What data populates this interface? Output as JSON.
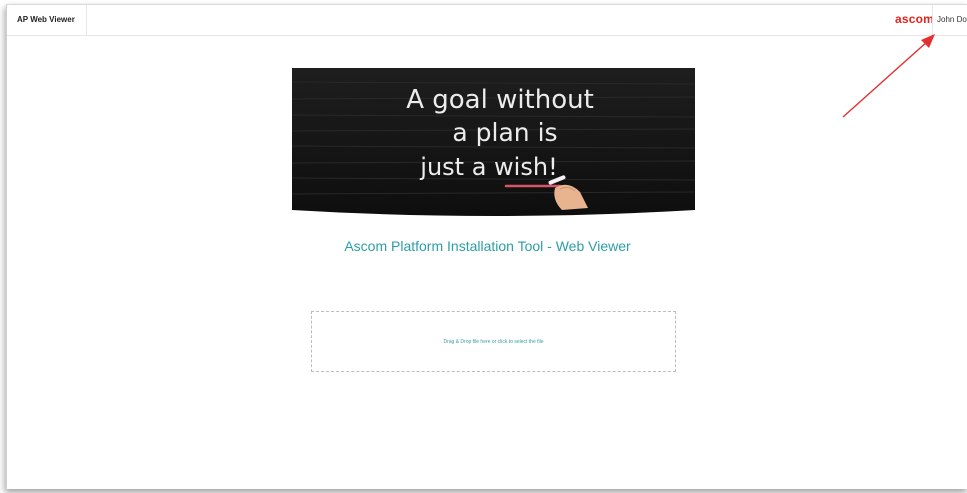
{
  "header": {
    "app_title": "AP Web Viewer",
    "brand_logo": "ascom",
    "user_name": "John Doe"
  },
  "hero": {
    "lines": [
      "A goal without",
      "a plan is",
      "just a wish!"
    ]
  },
  "main": {
    "title": "Ascom Platform Installation Tool - Web Viewer",
    "dropzone_text": "Drag & Drop file here or click to select the file"
  },
  "colors": {
    "brand": "#e2231a",
    "accent": "#2b9fa6",
    "annotation_arrow": "#e33131"
  }
}
